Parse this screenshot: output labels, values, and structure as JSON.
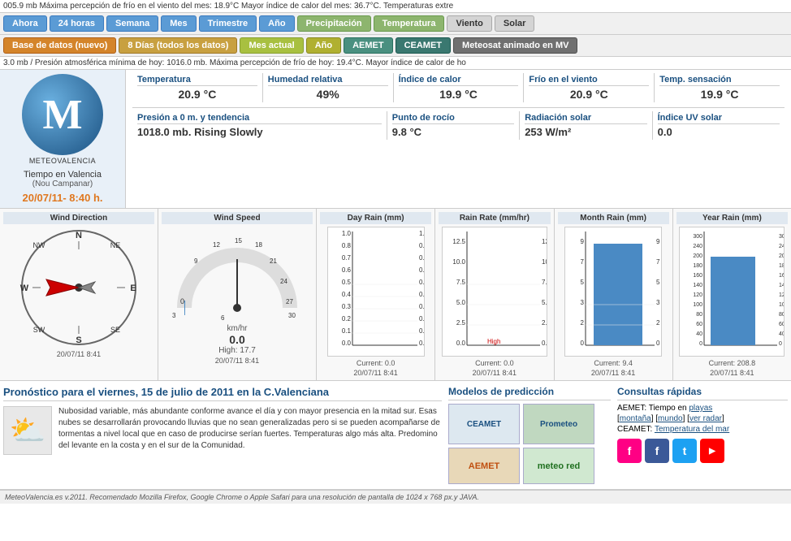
{
  "topBar": {
    "text": "005.9 mb    Máxima percepción de frío en el viento del mes: 18.9°C    Mayor índice de calor del mes: 36.7°C. Temperaturas extre"
  },
  "nav1": {
    "btn1": "Ahora",
    "btn2": "24 horas",
    "btn3": "Semana",
    "btn4": "Mes",
    "btn5": "Trimestre",
    "btn6": "Año",
    "btn7": "Precipitación",
    "btn8": "Temperatura",
    "btn9": "Viento",
    "btn10": "Solar"
  },
  "nav2": {
    "btn1": "Base de datos (nuevo)",
    "btn2": "8 Días (todos los datos)",
    "btn3": "Mes actual",
    "btn4": "Año",
    "btn5": "AEMET",
    "btn6": "CEAMET",
    "btn7": "Meteosat animado en MV"
  },
  "infoBar2": {
    "text": "3.0 mb / Presión atmosférica mínima de hoy: 1016.0 mb.    Máxima percepción de frío de hoy: 19.4°C. Mayor índice de calor de ho"
  },
  "location": {
    "name": "Tiempo en Valencia",
    "sub": "(Nou Campanar)",
    "dateTime": "20/07/11- 8:40 h."
  },
  "weather": {
    "temperatura_label": "Temperatura",
    "temperatura_val": "20.9 °C",
    "humedad_label": "Humedad relativa",
    "humedad_val": "49%",
    "calor_label": "Índice de calor",
    "calor_val": "19.9 °C",
    "frio_label": "Frío en el viento",
    "frio_val": "20.9 °C",
    "sensacion_label": "Temp. sensación",
    "sensacion_val": "19.9 °C",
    "presion_label": "Presión a 0 m. y tendencia",
    "presion_val": "1018.0 mb. Rising Slowly",
    "rocio_label": "Punto de rocío",
    "rocio_val": "9.8 °C",
    "solar_label": "Radiación solar",
    "solar_val": "253 W/m²",
    "uv_label": "Índice UV solar",
    "uv_val": "0.0"
  },
  "windDirection": {
    "title": "Wind Direction",
    "timestamp": "20/07/11   8:41"
  },
  "windSpeed": {
    "title": "Wind Speed",
    "unit": "km/hr",
    "value": "0.0",
    "high": "High: 17.7",
    "timestamp": "20/07/11   8:41"
  },
  "charts": {
    "dayRain": {
      "title": "Day Rain (mm)",
      "current": "Current: 0.0",
      "timestamp": "20/07/11   8:41"
    },
    "rainRate": {
      "title": "Rain Rate (mm/hr)",
      "current": "Current: 0.0",
      "high_label": "High",
      "timestamp": "20/07/11   8:41"
    },
    "monthRain": {
      "title": "Month Rain (mm)",
      "current": "Current: 9.4",
      "timestamp": "20/07/11   8:41"
    },
    "yearRain": {
      "title": "Year Rain (mm)",
      "current": "Current: 208.8",
      "timestamp": "20/07/11   8:41"
    }
  },
  "forecast": {
    "title": "Pronóstico para el viernes, 15 de julio de 2011 en la C.Valenciana",
    "text": "Nubosidad variable, más abundante conforme avance el día y con mayor presencia en la mitad sur. Esas nubes se desarrollarán provocando lluvias que no sean generalizadas pero si se pueden acompañarse de tormentas a nivel local que en caso de producirse serían fuertes. Temperaturas algo más alta. Predomino del levante en la costa y en el sur de la Comunidad."
  },
  "models": {
    "title": "Modelos de predicción",
    "logo1": "CEAMET",
    "logo2": "Prometeo"
  },
  "quickLinks": {
    "title": "Consultas rápidas",
    "line1_prefix": "AEMET: Tiempo en ",
    "playas": "playas",
    "montana": "montaña",
    "mundo": "mundo",
    "verRadar": "ver radar",
    "ceamet_prefix": "CEAMET: ",
    "tempMar": "Temperatura del mar"
  },
  "footer": {
    "text": "MeteoValencia.es v.2011. Recomendado Mozilla Firefox, Google Chrome o Apple Safari para una resolución de pantalla de 1024 x 768 px.y JAVA."
  }
}
